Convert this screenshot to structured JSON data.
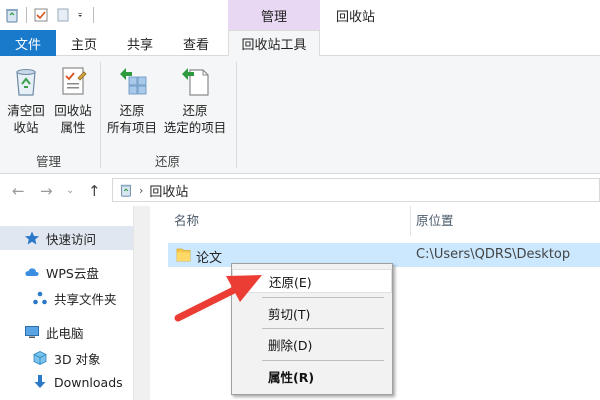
{
  "titlebar": {
    "context_tab": "管理",
    "window_title": "回收站"
  },
  "tabs": {
    "file": "文件",
    "home": "主页",
    "share": "共享",
    "view": "查看",
    "tools": "回收站工具"
  },
  "ribbon": {
    "empty_bin_line1": "清空回",
    "empty_bin_line2": "收站",
    "properties_line1": "回收站",
    "properties_line2": "属性",
    "restore_all_line1": "还原",
    "restore_all_line2": "所有项目",
    "restore_selected_line1": "还原",
    "restore_selected_line2": "选定的项目",
    "group_manage": "管理",
    "group_restore": "还原"
  },
  "address": {
    "path": "回收站"
  },
  "nav": {
    "quick_access": "快速访问",
    "wps_cloud": "WPS云盘",
    "shared_folder": "共享文件夹",
    "this_pc": "此电脑",
    "objects_3d": "3D 对象",
    "downloads": "Downloads"
  },
  "columns": {
    "name": "名称",
    "original_location": "原位置"
  },
  "files": [
    {
      "name": "论文",
      "location": "C:\\Users\\QDRS\\Desktop"
    }
  ],
  "context_menu": {
    "restore": "还原(E)",
    "cut": "剪切(T)",
    "delete": "删除(D)",
    "properties": "属性(R)"
  },
  "colors": {
    "file_tab": "#1979ca",
    "context_tab": "#e8d8f4",
    "selection": "#cce8ff",
    "arrow": "#ec3d35"
  }
}
